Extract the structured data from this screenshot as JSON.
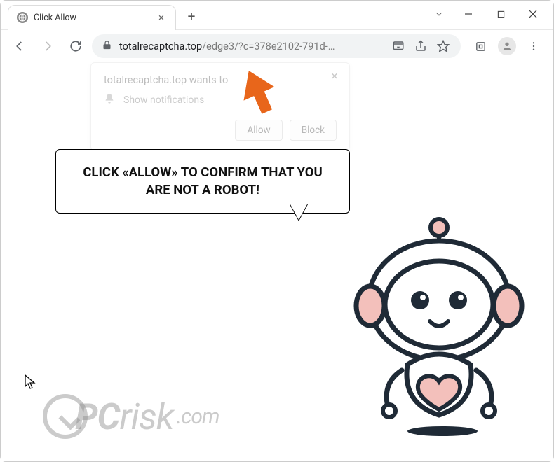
{
  "window": {
    "tab_title": "Click Allow"
  },
  "omnibox": {
    "host": "totalrecaptcha.top",
    "path": "/edge3/?c=378e2102-791d-…"
  },
  "prompt": {
    "origin": "totalrecaptcha.top wants to",
    "permission": "Show notifications",
    "allow": "Allow",
    "block": "Block"
  },
  "bubble": {
    "text": "CLICK «ALLOW» TO CONFIRM THAT YOU ARE NOT A ROBOT!"
  },
  "watermark": {
    "brand_pc": "PC",
    "brand_risk": "risk",
    "tld": ".com"
  },
  "colors": {
    "arrow": "#e8661b",
    "robot_outline": "#1f2a36",
    "robot_accent": "#f3c0bb"
  }
}
